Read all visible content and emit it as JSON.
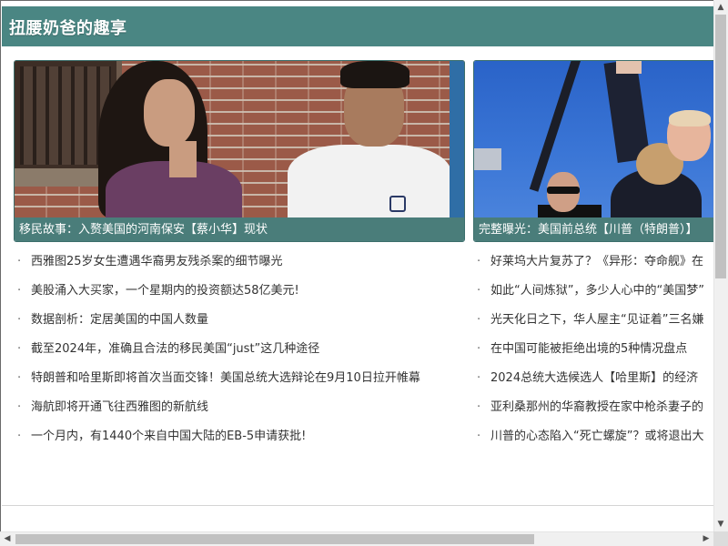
{
  "header": {
    "title": "扭腰奶爸的趣享",
    "bg_color": "#4a8683"
  },
  "featured": [
    {
      "caption": "移民故事：入赘美国的河南保安【蔡小华】现状",
      "image_icon": "photo-icon"
    },
    {
      "caption": "完整曝光：美国前总统【川普（特朗普）】",
      "image_icon": "photo-icon"
    }
  ],
  "list_left": [
    "西雅图25岁女生遭遇华裔男友残杀案的细节曝光",
    "美股涌入大买家，一个星期内的投资额达58亿美元!",
    "数据剖析：定居美国的中国人数量",
    "截至2024年，准确且合法的移民美国“just”这几种途径",
    "特朗普和哈里斯即将首次当面交锋！美国总统大选辩论在9月10日拉开帷幕",
    "海航即将开通飞往西雅图的新航线",
    "一个月内，有1440个来自中国大陆的EB-5申请获批!"
  ],
  "list_right": [
    "好莱坞大片复苏了？《异形：夺命舰》在",
    "如此“人间炼狱”，多少人心中的“美国梦”",
    "光天化日之下，华人屋主“见证着”三名嫌",
    "在中国可能被拒绝出境的5种情况盘点",
    "2024总统大选候选人【哈里斯】的经济",
    "亚利桑那州的华裔教授在家中枪杀妻子的",
    "川普的心态陷入“死亡螺旋”？或将退出大"
  ],
  "bullet": "·",
  "scroll": {
    "up": "▲",
    "down": "▼",
    "left": "◀",
    "right": "▶"
  }
}
